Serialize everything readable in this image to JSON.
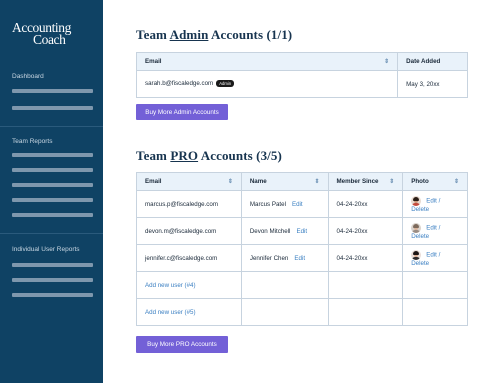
{
  "sidebar": {
    "logo_line1": "Accounting",
    "logo_line2": "Coach",
    "sections": [
      {
        "label": "Dashboard"
      },
      {
        "label": "Team Reports"
      },
      {
        "label": "Individual User Reports"
      }
    ]
  },
  "admin": {
    "title_prefix": "Team ",
    "title_emph": "Admin",
    "title_suffix": " Accounts (1/1)",
    "columns": [
      "Email",
      "Date Added"
    ],
    "row": {
      "email": "sarah.b@fiscaledge.com",
      "badge": "Admin",
      "date": "May 3, 20xx"
    },
    "button": "Buy More Admin Accounts"
  },
  "pro": {
    "title_prefix": "Team ",
    "title_emph": "PRO",
    "title_suffix": " Accounts (3/5)",
    "columns": [
      "Email",
      "Name",
      "Member Since",
      "Photo"
    ],
    "rows": [
      {
        "email": "marcus.p@fiscaledge.com",
        "name": "Marcus Patel",
        "edit": "Edit",
        "since": "04-24-20xx",
        "photo_action": "Edit / Delete"
      },
      {
        "email": "devon.m@fiscaledge.com",
        "name": "Devon Mitchell",
        "edit": "Edit",
        "since": "04-24-20xx",
        "photo_action": "Edit / Delete"
      },
      {
        "email": "jennifer.c@fiscaledge.com",
        "name": "Jennifer Chen",
        "edit": "Edit",
        "since": "04-24-20xx",
        "photo_action": "Edit / Delete"
      }
    ],
    "add_rows": [
      "Add new user (#4)",
      "Add new user (#5)"
    ],
    "button": "Buy More PRO Accounts"
  },
  "colors": {
    "sidebar": "#0f4264",
    "accent": "#7360d7",
    "header_bg": "#e9f2fa",
    "link": "#3a7fc2"
  },
  "icons": {
    "sort": "sort-arrows-icon"
  }
}
